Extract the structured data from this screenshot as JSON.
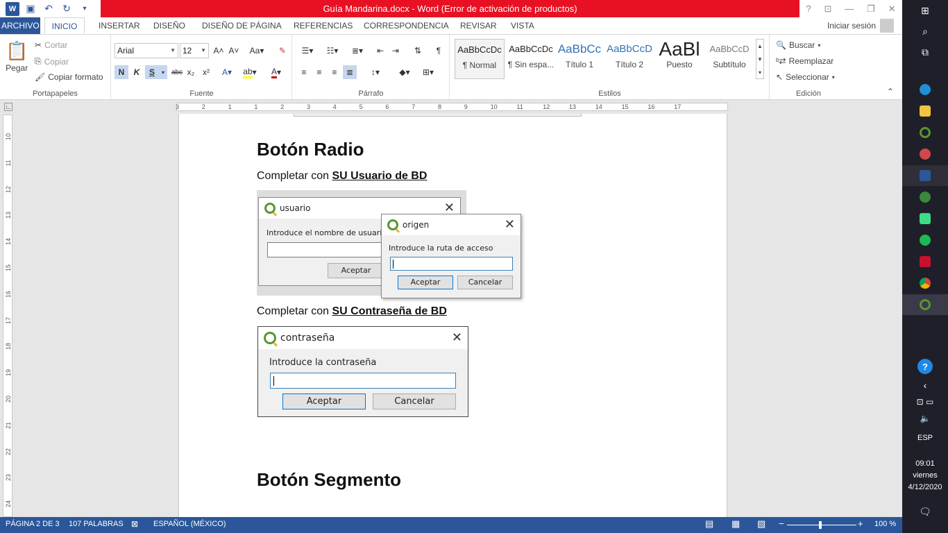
{
  "window": {
    "title": "Guía Mandarina.docx -  Word (Error de activación de productos)",
    "controls": [
      "?",
      "⧉",
      "—",
      "❐",
      "✕"
    ]
  },
  "qat": {
    "word_icon": "W",
    "save": "💾",
    "undo": "↶",
    "redo": "↻",
    "more": "⇩"
  },
  "tabs": [
    "ARCHIVO",
    "INICIO",
    "INSERTAR",
    "DISEÑO",
    "DISEÑO DE PÁGINA",
    "REFERENCIAS",
    "CORRESPONDENCIA",
    "REVISAR",
    "VISTA"
  ],
  "signin": "Iniciar sesión",
  "ribbon": {
    "clipboard": {
      "paste": "Pegar",
      "cut": "Cortar",
      "copy": "Copiar",
      "format_painter": "Copiar formato",
      "label": "Portapapeles"
    },
    "font": {
      "family": "Arial",
      "size": "12",
      "label": "Fuente",
      "bold": "N",
      "italic": "K",
      "underline": "S",
      "strike": "abc",
      "sub": "x₂",
      "sup": "x²"
    },
    "paragraph": {
      "label": "Párrafo"
    },
    "styles": {
      "label": "Estilos",
      "items": [
        {
          "preview": "AaBbCcDc",
          "name": "¶ Normal"
        },
        {
          "preview": "AaBbCcDc",
          "name": "¶ Sin espa..."
        },
        {
          "preview": "AaBbCc",
          "name": "Título 1"
        },
        {
          "preview": "AaBbCcD",
          "name": "Título 2"
        },
        {
          "preview": "AaBl",
          "name": "Puesto"
        },
        {
          "preview": "AaBbCcD",
          "name": "Subtítulo"
        }
      ]
    },
    "editing": {
      "label": "Edición",
      "find": "Buscar",
      "replace": "Reemplazar",
      "select": "Seleccionar"
    }
  },
  "ruler": {
    "h": [
      "3",
      "2",
      "1",
      "1",
      "2",
      "3",
      "4",
      "5",
      "6",
      "7",
      "8",
      "9",
      "10",
      "11",
      "12",
      "13",
      "14",
      "15",
      "16",
      "17"
    ],
    "v": [
      "10",
      "11",
      "12",
      "13",
      "14",
      "15",
      "16",
      "17",
      "18",
      "19",
      "20",
      "21",
      "22",
      "23",
      "24"
    ]
  },
  "document": {
    "heading1": "Botón  Radio",
    "line1_prefix": "Completar con ",
    "line1_bold": "SU Usuario de BD",
    "line2_prefix": "Completar con ",
    "line2_bold": "SU Contraseña de BD",
    "heading2": "Botón  Segmento"
  },
  "dialog_usuario": {
    "title": "usuario",
    "prompt": "Introduce el nombre de usuario d",
    "ok": "Aceptar"
  },
  "dialog_origen": {
    "title": "origen",
    "prompt": "Introduce la ruta de acceso",
    "ok": "Aceptar",
    "cancel": "Cancelar"
  },
  "dialog_contrasena": {
    "title": "contraseña",
    "prompt": "Introduce la contraseña",
    "ok": "Aceptar",
    "cancel": "Cancelar"
  },
  "status": {
    "page": "PÁGINA 2 DE 3",
    "words": "107 PALABRAS",
    "language": "ESPAÑOL (MÉXICO)",
    "zoom": "100 %"
  },
  "taskbar": {
    "lang": "ESP",
    "time": "09:01",
    "day": "viernes",
    "date": "4/12/2020"
  },
  "colors": {
    "word_blue": "#2b579a",
    "error_red": "#e81123",
    "qgis_green": "#589632"
  }
}
